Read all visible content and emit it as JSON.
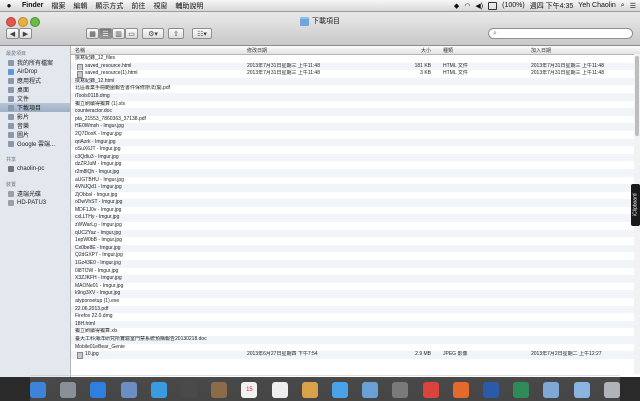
{
  "menubar": {
    "app": "Finder",
    "items": [
      "檔案",
      "編輯",
      "顯示方式",
      "前往",
      "視窗",
      "輔助說明"
    ],
    "battery": "(100%)",
    "clock": "週四 下午4:35",
    "user": "Yeh Chaolin"
  },
  "window": {
    "title": "下載項目",
    "search_placeholder": ""
  },
  "sidebar": {
    "favorites_header": "最愛項目",
    "favorites": [
      {
        "label": "我的所有檔案",
        "icon": "all-files-icon",
        "color": "#8a99ad"
      },
      {
        "label": "AirDrop",
        "icon": "airdrop-icon",
        "color": "#5a9ad6"
      },
      {
        "label": "應用程式",
        "icon": "applications-icon",
        "color": "#8a99ad"
      },
      {
        "label": "桌面",
        "icon": "desktop-icon",
        "color": "#8a99ad"
      },
      {
        "label": "文件",
        "icon": "documents-icon",
        "color": "#8a99ad"
      },
      {
        "label": "下載項目",
        "icon": "downloads-icon",
        "color": "#8a99ad"
      },
      {
        "label": "影片",
        "icon": "movies-icon",
        "color": "#8a99ad"
      },
      {
        "label": "音樂",
        "icon": "music-icon",
        "color": "#8a99ad"
      },
      {
        "label": "圖片",
        "icon": "pictures-icon",
        "color": "#8a99ad"
      },
      {
        "label": "Google 雲端...",
        "icon": "google-drive-icon",
        "color": "#8a99ad"
      }
    ],
    "shared_header": "共享",
    "shared": [
      {
        "label": "chaolin-pc",
        "icon": "computer-icon",
        "color": "#6f7782"
      }
    ],
    "devices_header": "裝置",
    "devices": [
      {
        "label": "遠端光碟",
        "icon": "remote-disc-icon",
        "color": "#9aa0a8"
      },
      {
        "label": "HD-PATU3",
        "icon": "drive-icon",
        "color": "#9aa0a8"
      }
    ]
  },
  "columns": {
    "name": "名稱",
    "modified": "修改日期",
    "size": "大小",
    "kind": "種類",
    "added": "加入日期"
  },
  "files": [
    {
      "name": "撰寫紀錄_12_files",
      "modified": "",
      "size": "",
      "kind": "",
      "added": ""
    },
    {
      "name": "saved_resource.html",
      "modified": "2013年7月31日星期三 上午11:48",
      "size": "181 KB",
      "kind": "HTML 文件",
      "added": "2013年7月31日星期三 上午11:48"
    },
    {
      "name": "saved_resource(1).html",
      "modified": "2013年7月31日星期三 上午11:48",
      "size": "3 KB",
      "kind": "HTML 文件",
      "added": "2013年7月31日星期三 上午11:48"
    },
    {
      "name": "撰寫紀錄_12.html",
      "modified": "",
      "size": "",
      "kind": "",
      "added": ""
    },
    {
      "name": "北區專業手冊範圍報告書件保修辦法(開.pdf",
      "modified": "",
      "size": "",
      "kind": "",
      "added": ""
    },
    {
      "name": "iTools0118.dmg",
      "modified": "",
      "size": "",
      "kind": "",
      "added": ""
    },
    {
      "name": "獨立刷續得獨算 (1).xls",
      "modified": "",
      "size": "",
      "kind": "",
      "added": ""
    },
    {
      "name": "counteractor.doc",
      "modified": "",
      "size": "",
      "kind": "",
      "added": ""
    },
    {
      "name": "pta_21553_7860363_37138.pdf",
      "modified": "",
      "size": "",
      "kind": "",
      "added": ""
    },
    {
      "name": "HE0Wmsh - Imgur.jpg",
      "modified": "",
      "size": "",
      "kind": "",
      "added": ""
    },
    {
      "name": "2Q7DosK - Imgur.jpg",
      "modified": "",
      "size": "",
      "kind": "",
      "added": ""
    },
    {
      "name": "qriAzrk - Imgur.jpg",
      "modified": "",
      "size": "",
      "kind": "",
      "added": ""
    },
    {
      "name": "oSuX6JT - Imgur.jpg",
      "modified": "",
      "size": "",
      "kind": "",
      "added": ""
    },
    {
      "name": "c3Qdlu3 - Imgur.jpg",
      "modified": "",
      "size": "",
      "kind": "",
      "added": ""
    },
    {
      "name": "dzZRJuM - Imgur.jpg",
      "modified": "",
      "size": "",
      "kind": "",
      "added": ""
    },
    {
      "name": "r2m8lQh - Imgur.jpg",
      "modified": "",
      "size": "",
      "kind": "",
      "added": ""
    },
    {
      "name": "aUGTBHU - Imgur.jpg",
      "modified": "",
      "size": "",
      "kind": "",
      "added": ""
    },
    {
      "name": "4VNJQd1 - Imgur.jpg",
      "modified": "",
      "size": "",
      "kind": "",
      "added": ""
    },
    {
      "name": "ZjObbsl - Imgur.jpg",
      "modified": "",
      "size": "",
      "kind": "",
      "added": ""
    },
    {
      "name": "oDwVhST - Imgur.jpg",
      "modified": "",
      "size": "",
      "kind": "",
      "added": ""
    },
    {
      "name": "MDF1J0v - Imgur.jpg",
      "modified": "",
      "size": "",
      "kind": "",
      "added": ""
    },
    {
      "name": "cxLLTHy - Imgur.jpg",
      "modified": "",
      "size": "",
      "kind": "",
      "added": ""
    },
    {
      "name": "zWWarLg - Imgur.jpg",
      "modified": "",
      "size": "",
      "kind": "",
      "added": ""
    },
    {
      "name": "qUC2Yaz - Imgur.jpg",
      "modified": "",
      "size": "",
      "kind": "",
      "added": ""
    },
    {
      "name": "1epW0bB - Imgur.jpg",
      "modified": "",
      "size": "",
      "kind": "",
      "added": ""
    },
    {
      "name": "Cx0be8E - Imgur.jpg",
      "modified": "",
      "size": "",
      "kind": "",
      "added": ""
    },
    {
      "name": "Q2dGXP7 - Imgur.jpg",
      "modified": "",
      "size": "",
      "kind": "",
      "added": ""
    },
    {
      "name": "1Gz43E0 - Imgur.jpg",
      "modified": "",
      "size": "",
      "kind": "",
      "added": ""
    },
    {
      "name": "0l8TOW - Imgur.jpg",
      "modified": "",
      "size": "",
      "kind": "",
      "added": ""
    },
    {
      "name": "X3ZJKFH - Imgur.jpg",
      "modified": "",
      "size": "",
      "kind": "",
      "added": ""
    },
    {
      "name": "MAONe01 - Imgur.jpg",
      "modified": "",
      "size": "",
      "kind": "",
      "added": ""
    },
    {
      "name": "k9ng3XV - Imgur.jpg",
      "modified": "",
      "size": "",
      "kind": "",
      "added": ""
    },
    {
      "name": "atyponsetup (1).exe",
      "modified": "",
      "size": "",
      "kind": "",
      "added": ""
    },
    {
      "name": "22.06.2013.pdf",
      "modified": "",
      "size": "",
      "kind": "",
      "added": ""
    },
    {
      "name": "Firefox 22.0.dmg",
      "modified": "",
      "size": "",
      "kind": "",
      "added": ""
    },
    {
      "name": "18H.html",
      "modified": "",
      "size": "",
      "kind": "",
      "added": ""
    },
    {
      "name": "獨立刷續得獨算.xls",
      "modified": "",
      "size": "",
      "kind": "",
      "added": ""
    },
    {
      "name": "臺大工科海洋研究所實驗室門禁系統預購報告20130218.doc",
      "modified": "",
      "size": "",
      "kind": "",
      "added": ""
    },
    {
      "name": "Mobile01eBear_Genie",
      "modified": "",
      "size": "",
      "kind": "",
      "added": ""
    },
    {
      "name": "10.jpg",
      "modified": "2013年6月27日星期四 下午7:54",
      "size": "2.9 MB",
      "kind": "JPEG 影像",
      "added": "2013年7月2日星期二 上午12:27"
    }
  ],
  "clipboard_tab": "iClipboard",
  "dock": {
    "items": [
      {
        "icon": "finder-icon",
        "color": "#3d84d8"
      },
      {
        "icon": "launchpad-icon",
        "color": "#8a8f99"
      },
      {
        "icon": "app-store-icon",
        "color": "#2f7fe0"
      },
      {
        "icon": "mail-icon",
        "color": "#6b8fc4"
      },
      {
        "icon": "safari-icon",
        "color": "#3a9be0"
      },
      {
        "icon": "facetime-icon",
        "color": "#4a4a4a"
      },
      {
        "icon": "contacts-icon",
        "color": "#8b6b4a"
      },
      {
        "icon": "calendar-icon",
        "color": "#f2f2f2",
        "text": "15"
      },
      {
        "icon": "reminders-icon",
        "color": "#eeeeee"
      },
      {
        "icon": "photos-icon",
        "color": "#d9a24a"
      },
      {
        "icon": "messages-icon",
        "color": "#4aa3e8"
      },
      {
        "icon": "itunes-icon",
        "color": "#6aa0d8"
      },
      {
        "icon": "system-preferences-icon",
        "color": "#7a7a7a"
      },
      {
        "icon": "chrome-icon",
        "color": "#d9453a"
      },
      {
        "icon": "firefox-icon",
        "color": "#e36a2a"
      },
      {
        "icon": "word-icon",
        "color": "#2a5aa8"
      },
      {
        "icon": "excel-icon",
        "color": "#2e8b57"
      },
      {
        "icon": "documents-folder-icon",
        "color": "#7fa8d6"
      },
      {
        "icon": "downloads-stack-icon",
        "color": "#8cb4e0"
      },
      {
        "icon": "trash-icon",
        "color": "#b0b4b8"
      }
    ]
  }
}
